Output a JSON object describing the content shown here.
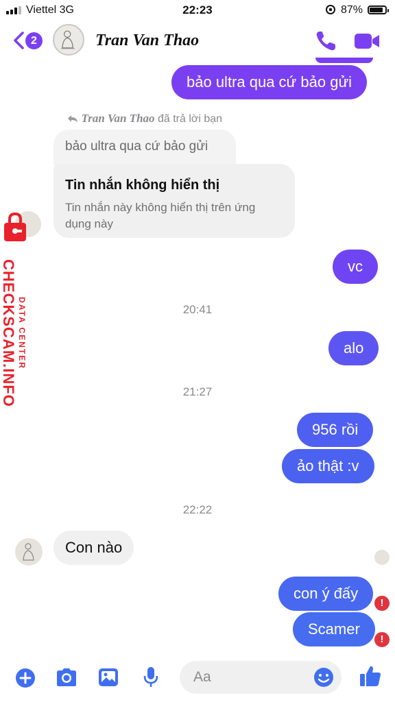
{
  "status_bar": {
    "carrier": "Viettel  3G",
    "time": "22:23",
    "battery_percent": "87%",
    "battery_level": 0.87
  },
  "header": {
    "back_badge": "2",
    "contact_name": "Tran Van Thao"
  },
  "messages": {
    "top_sent": "bảo ultra qua cứ bảo gửi",
    "reply_note_name": "Tran Van Thao",
    "reply_note_text": " đã trả lời bạn",
    "quoted_text": "bảo ultra qua cứ bảo gửi",
    "hidden_title": "Tin nhắn không hiển thị",
    "hidden_desc": "Tin nhắn này không hiển thị trên ứng dụng này",
    "sent_vc": "vc",
    "time_1": "20:41",
    "sent_alo": "alo",
    "time_2": "21:27",
    "sent_956": "956 rồi",
    "sent_aothat": "ảo thật :v",
    "time_3": "22:22",
    "recv_connao": "Con nào",
    "sent_conyday": "con ý đấy",
    "sent_scamer": "Scamer",
    "error_mark": "!"
  },
  "watermark": {
    "brand": "CHECKSCAM.INFO",
    "tagline": "DATA CENTER"
  },
  "composer": {
    "placeholder": "Aa"
  },
  "colors": {
    "accent": "#7b3ff2",
    "bubble_purple": "#7143f3",
    "bubble_blue": "#4b63f0",
    "error": "#e0353f",
    "watermark": "#e8212b"
  }
}
